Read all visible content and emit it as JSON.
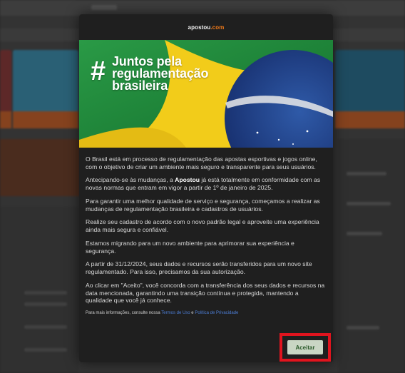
{
  "modal": {
    "logo": {
      "brand": "apostou",
      "suffix": ".com"
    },
    "hero": {
      "hash": "#",
      "lines": [
        "Juntos pela",
        "regulamentação",
        "brasileira"
      ]
    },
    "paragraphs": {
      "p1": "O Brasil está em processo de regulamentação das apostas esportivas e jogos online, com o objetivo de criar um ambiente mais seguro e transparente para seus usuários.",
      "p2_before": "Antecipando-se às mudanças, a ",
      "p2_bold": "Apostou",
      "p2_after": " já está totalmente em conformidade com as novas normas que entram em vigor a partir de 1º de janeiro de 2025.",
      "p3": "Para garantir uma melhor qualidade de serviço e segurança, começamos a realizar as mudanças de regulamentação brasileira e cadastros de usuários.",
      "p4": "Realize seu cadastro de acordo com o novo padrão legal e aproveite uma experiência ainda mais segura e confiável.",
      "p5": "Estamos migrando para um novo ambiente para aprimorar sua experiência e segurança.",
      "p6": "A partir de 31/12/2024, seus dados e recursos serão transferidos para um novo site regulamentado. Para isso, precisamos da sua autorização.",
      "p7": "Ao clicar em \"Aceito\", você concorda com a transferência dos seus dados e recursos na data mencionada, garantindo uma transição contínua e protegida, mantendo a qualidade que você já conhece."
    },
    "info": {
      "prefix": "Para mais informações, consulte nossa ",
      "terms_link": "Termos de Uso",
      "and": " e ",
      "privacy_link": "Política de Privacidade"
    },
    "accept_label": "Aceitar"
  },
  "colors": {
    "modal_bg": "#1f1f1f",
    "accent": "#f07a1a",
    "link": "#4d7fd8",
    "highlight": "#e0141e",
    "flag_green": "#1f8a3c",
    "flag_yellow": "#f2cc1a",
    "flag_blue": "#1f3f8f"
  }
}
